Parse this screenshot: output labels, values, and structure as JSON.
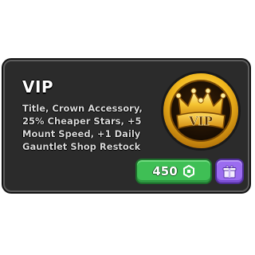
{
  "card": {
    "title": "VIP",
    "description": "Title, Crown Accessory, 25% Cheaper Stars, +5 Mount Speed, +1 Daily Gauntlet Shop Restock",
    "emblem_text": "VIP"
  },
  "purchase": {
    "price": "450",
    "currency_icon": "robux-icon",
    "gift_icon": "gift-icon"
  },
  "colors": {
    "card_background": "#2b2b2b",
    "price_button": "#3fbf55",
    "gift_button": "#9b6cf0",
    "emblem_gold": "#f2b81d"
  }
}
